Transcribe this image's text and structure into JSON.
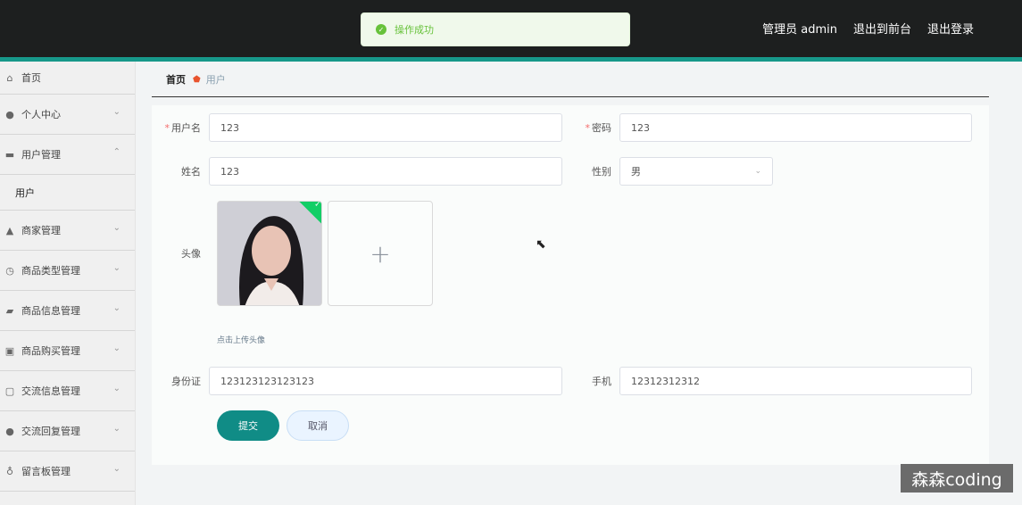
{
  "toast": {
    "message": "操作成功"
  },
  "header": {
    "admin": "管理员 admin",
    "to_front": "退出到前台",
    "logout": "退出登录"
  },
  "sidebar": {
    "items": [
      {
        "label": "首页",
        "icon": "home-icon"
      },
      {
        "label": "个人中心",
        "icon": "user-icon"
      },
      {
        "label": "用户管理",
        "icon": "users-icon",
        "sub": "用户"
      },
      {
        "label": "商家管理",
        "icon": "merchant-icon"
      },
      {
        "label": "商品类型管理",
        "icon": "clock-icon"
      },
      {
        "label": "商品信息管理",
        "icon": "ticket-icon"
      },
      {
        "label": "商品购买管理",
        "icon": "clipboard-icon"
      },
      {
        "label": "交流信息管理",
        "icon": "chat-icon"
      },
      {
        "label": "交流回复管理",
        "icon": "bulb-icon"
      },
      {
        "label": "留言板管理",
        "icon": "mic-icon"
      }
    ]
  },
  "breadcrumb": {
    "home": "首页",
    "current": "用户"
  },
  "form": {
    "username_label": "用户名",
    "username_value": "123",
    "password_label": "密码",
    "password_value": "123",
    "name_label": "姓名",
    "name_value": "123",
    "gender_label": "性别",
    "gender_value": "男",
    "avatar_label": "头像",
    "avatar_hint": "点击上传头像",
    "id_label": "身份证",
    "id_value": "123123123123123",
    "phone_label": "手机",
    "phone_value": "12312312312",
    "submit": "提交",
    "cancel": "取消"
  },
  "watermark": "森森coding",
  "colors": {
    "accent": "#108c86",
    "topbar": "#1d1f1f",
    "success": "#67c23a"
  }
}
